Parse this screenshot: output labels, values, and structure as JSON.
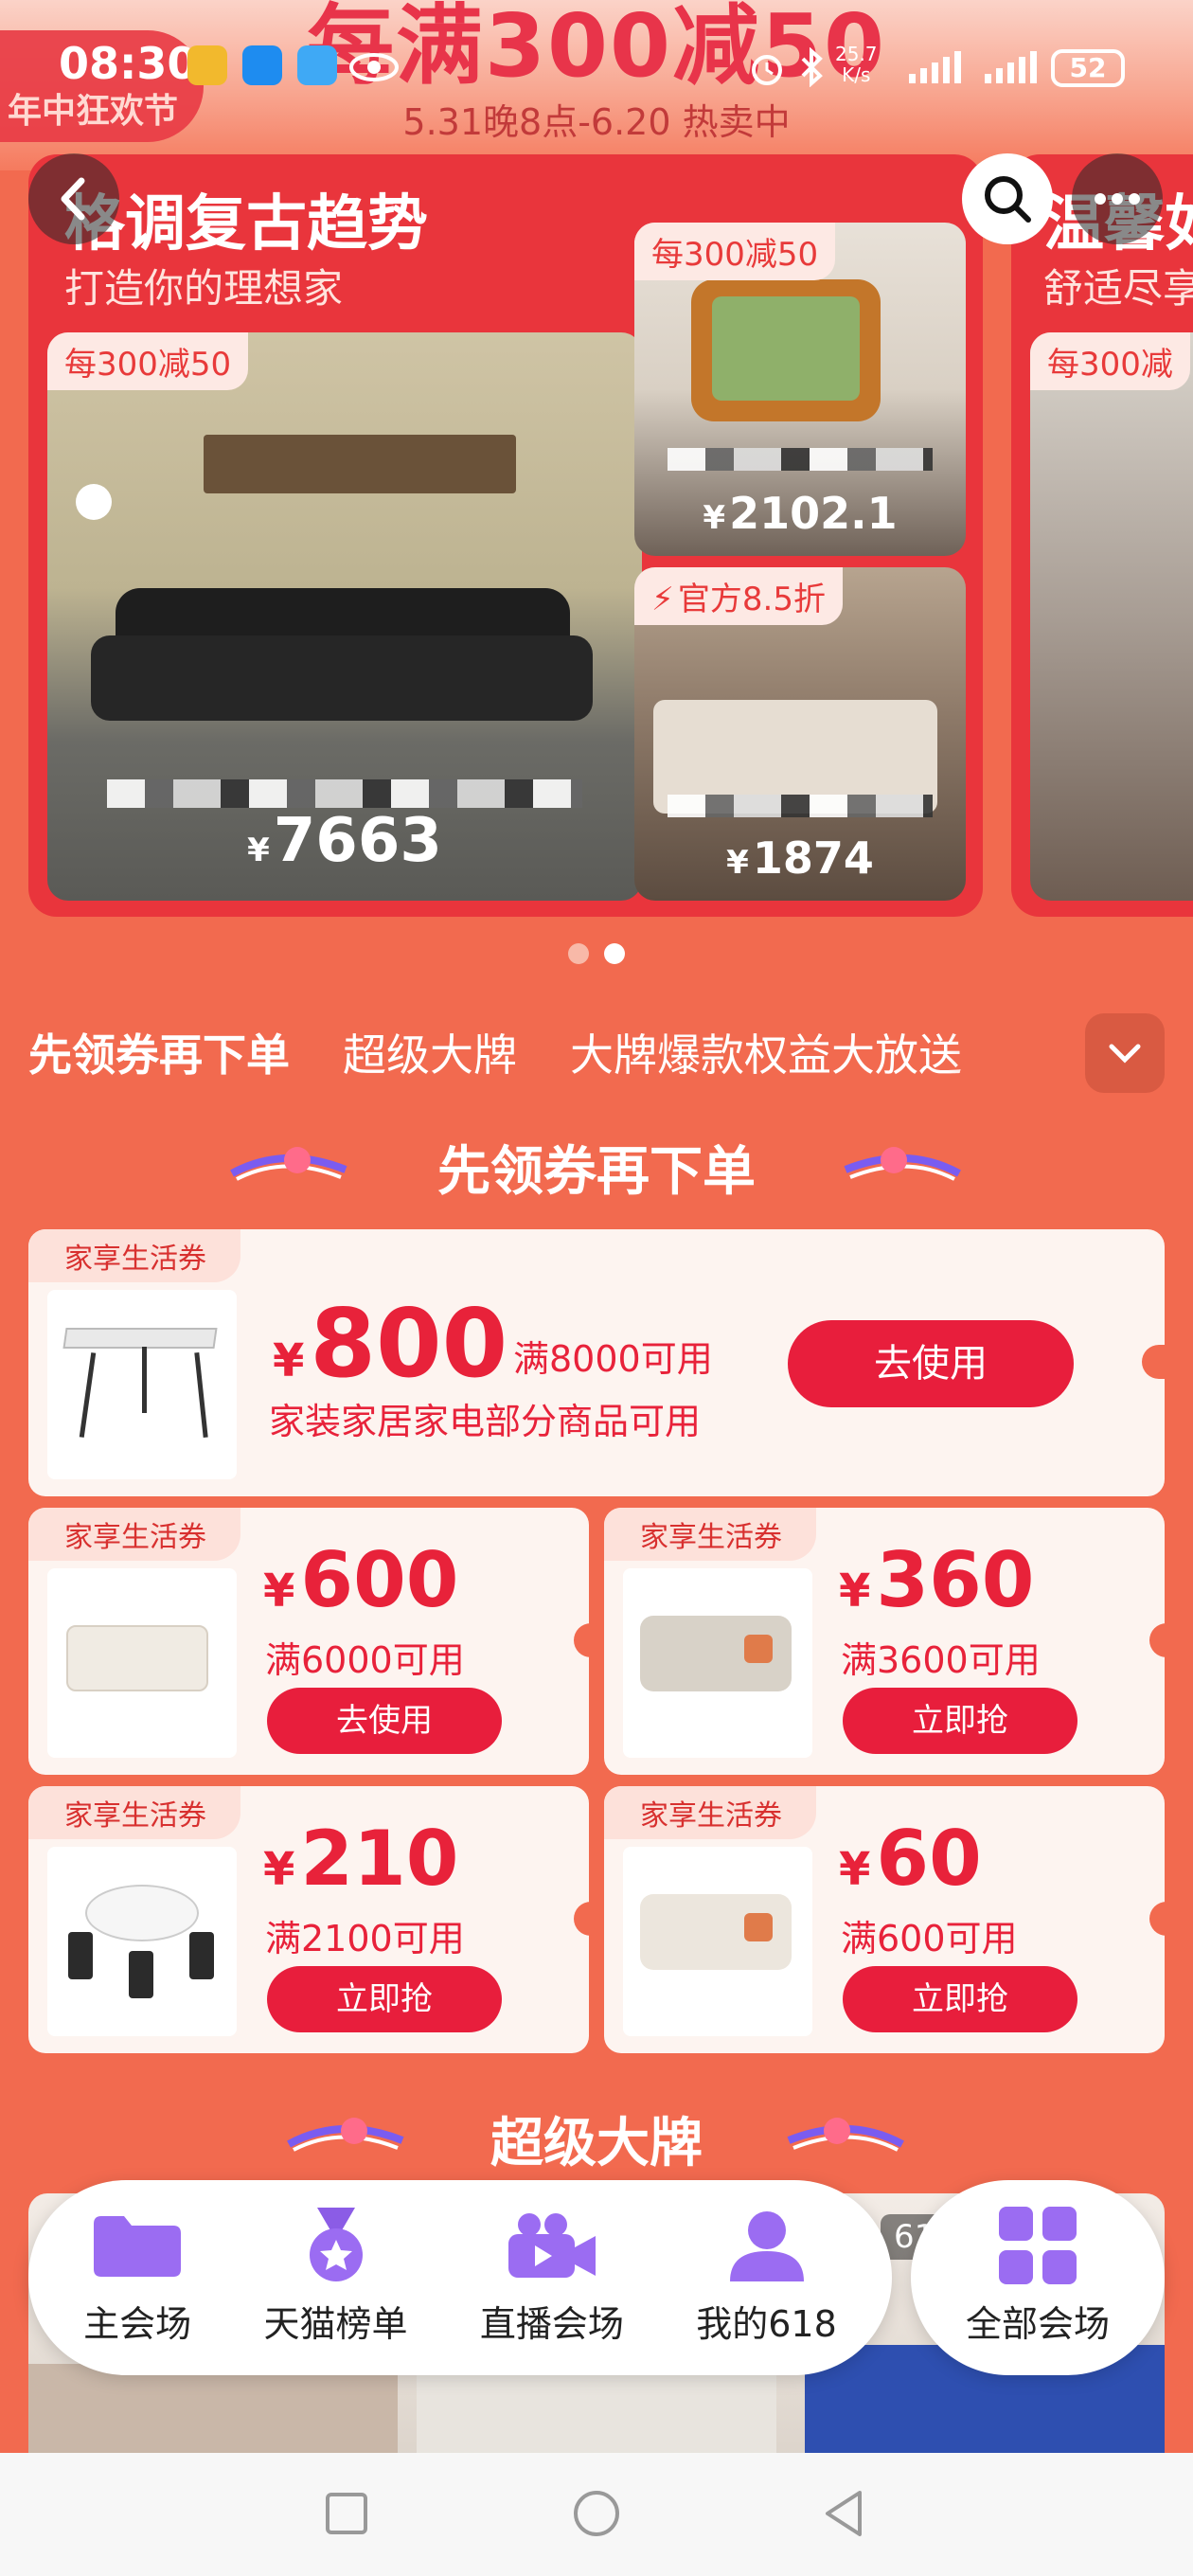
{
  "status_bar": {
    "time": "08:30",
    "net_speed_value": "25.7",
    "net_speed_unit": "K/s",
    "battery": "52"
  },
  "promo": {
    "headline": "每满300减50",
    "subline": "5.31晚8点-6.20 热卖中",
    "festival": "年中狂欢节"
  },
  "carousel": {
    "main": {
      "title": "格调复古趋势",
      "subtitle": "打造你的理想家",
      "items": [
        {
          "tag": "每300减50",
          "price": "7663"
        },
        {
          "tag": "每300减50",
          "price": "2102.1"
        },
        {
          "tag": "官方8.5折",
          "price": "1874"
        }
      ]
    },
    "next": {
      "title": "温馨如",
      "subtitle": "舒适尽享",
      "tag": "每300减"
    },
    "currency": "¥"
  },
  "section_tabs": [
    "先领券再下单",
    "超级大牌",
    "大牌爆款权益大放送"
  ],
  "coupon_section": {
    "heading": "先领券再下单",
    "coupons": [
      {
        "label": "家享生活券",
        "amount": "800",
        "condition": "满8000可用",
        "desc": "家装家居家电部分商品可用",
        "button": "去使用"
      },
      {
        "label": "家享生活券",
        "amount": "600",
        "condition": "满6000可用",
        "button": "去使用"
      },
      {
        "label": "家享生活券",
        "amount": "360",
        "condition": "满3600可用",
        "button": "立即抢"
      },
      {
        "label": "家享生活券",
        "amount": "210",
        "condition": "满2100可用",
        "button": "立即抢"
      },
      {
        "label": "家享生活券",
        "amount": "60",
        "condition": "满600可用",
        "button": "立即抢"
      }
    ]
  },
  "brand_section": {
    "heading": "超级大牌",
    "peek_text": "61"
  },
  "bottom_nav": {
    "items": [
      {
        "label": "主会场",
        "icon": "folder-icon"
      },
      {
        "label": "天猫榜单",
        "icon": "medal-icon"
      },
      {
        "label": "直播会场",
        "icon": "video-camera-icon"
      },
      {
        "label": "我的618",
        "icon": "user-icon"
      }
    ],
    "all": {
      "label": "全部会场",
      "icon": "grid-icon"
    }
  },
  "colors": {
    "page_bg": "#f26a4f",
    "card_red": "#e9353c",
    "coupon_red": "#e8223a",
    "nav_purple": "#9b6cf2"
  }
}
